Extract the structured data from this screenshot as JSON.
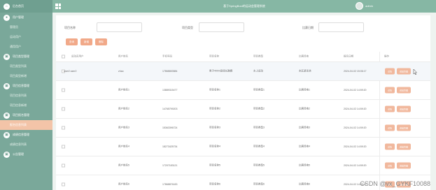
{
  "sidebar": {
    "top_label": "后台首页",
    "groups": [
      {
        "icon": "user-icon",
        "label": "用户管理",
        "items": [
          "管理员",
          "运动用户",
          "通用用户"
        ]
      },
      {
        "icon": "project-icon",
        "label": "项目类型管理",
        "items": [
          "项目类型列表",
          "项目类型新增"
        ]
      },
      {
        "icon": "project-icon",
        "label": "项目信息管理",
        "items": [
          "项目信息列表",
          "项目信息新增"
        ]
      },
      {
        "icon": "project-icon",
        "label": "项目报名管理",
        "items": [
          "报名信息列表"
        ]
      },
      {
        "icon": "project-icon",
        "label": "成绩信息管理",
        "items": [
          "成绩信息列表"
        ]
      },
      {
        "icon": "project-icon",
        "label": "公告管理",
        "items": []
      }
    ],
    "active_item": "报名信息列表"
  },
  "header": {
    "title": "基于SpringBoot的运动会管理系统",
    "username": "admin"
  },
  "filters": [
    {
      "label": "项目名称",
      "value": ""
    },
    {
      "label": "项目类型",
      "value": ""
    },
    {
      "label": "比赛日期",
      "value": ""
    }
  ],
  "buttons": {
    "search": "查询",
    "add": "新增",
    "delete": "删除"
  },
  "table": {
    "headers": [
      "运动员用户",
      "用户姓名",
      "手机号码",
      "项目名称",
      "项目类型",
      "比赛场地",
      "报名日期",
      "操作"
    ],
    "rows": [
      [
        "user2:user2",
        "zhao",
        "17868653584",
        "男子400m田径长跑赛",
        "水上运动",
        "东区游泳池",
        "2024-04-02 15:06:17"
      ],
      [
        "",
        "用户姓名1",
        "13889315477",
        "项目名称1",
        "项目类型1",
        "比赛场地1",
        "2024-04-02 14:59:20"
      ],
      [
        "",
        "用户姓名2",
        "14765799203",
        "项目名称2",
        "项目类型2",
        "比赛场地2",
        "2024-04-02 14:59:20"
      ],
      [
        "",
        "用户姓名3",
        "15363396724",
        "项目名称3",
        "项目类型3",
        "比赛场地3",
        "2024-04-02 14:59:20"
      ],
      [
        "",
        "用户姓名4",
        "18273425734",
        "项目名称4",
        "项目类型4",
        "比赛场地4",
        "2024-04-02 14:59:20"
      ],
      [
        "",
        "用户姓名5",
        "17207183121",
        "项目名称5",
        "项目类型5",
        "比赛场地5",
        "2024-04-02 14:59:20"
      ],
      [
        "",
        "用户姓名6",
        "17868876183",
        "项目名称6",
        "项目类型6",
        "比赛场地6",
        "2024-04-02 14:59:20"
      ]
    ],
    "op_buttons": [
      "详情",
      "成绩管理"
    ]
  },
  "watermark": "CSDN @vx_GYKF10088",
  "colors": {
    "sidebar": "#7aa89a",
    "header": "#86b7a4",
    "accent": "#f1a989",
    "active": "#f3c4a8"
  }
}
